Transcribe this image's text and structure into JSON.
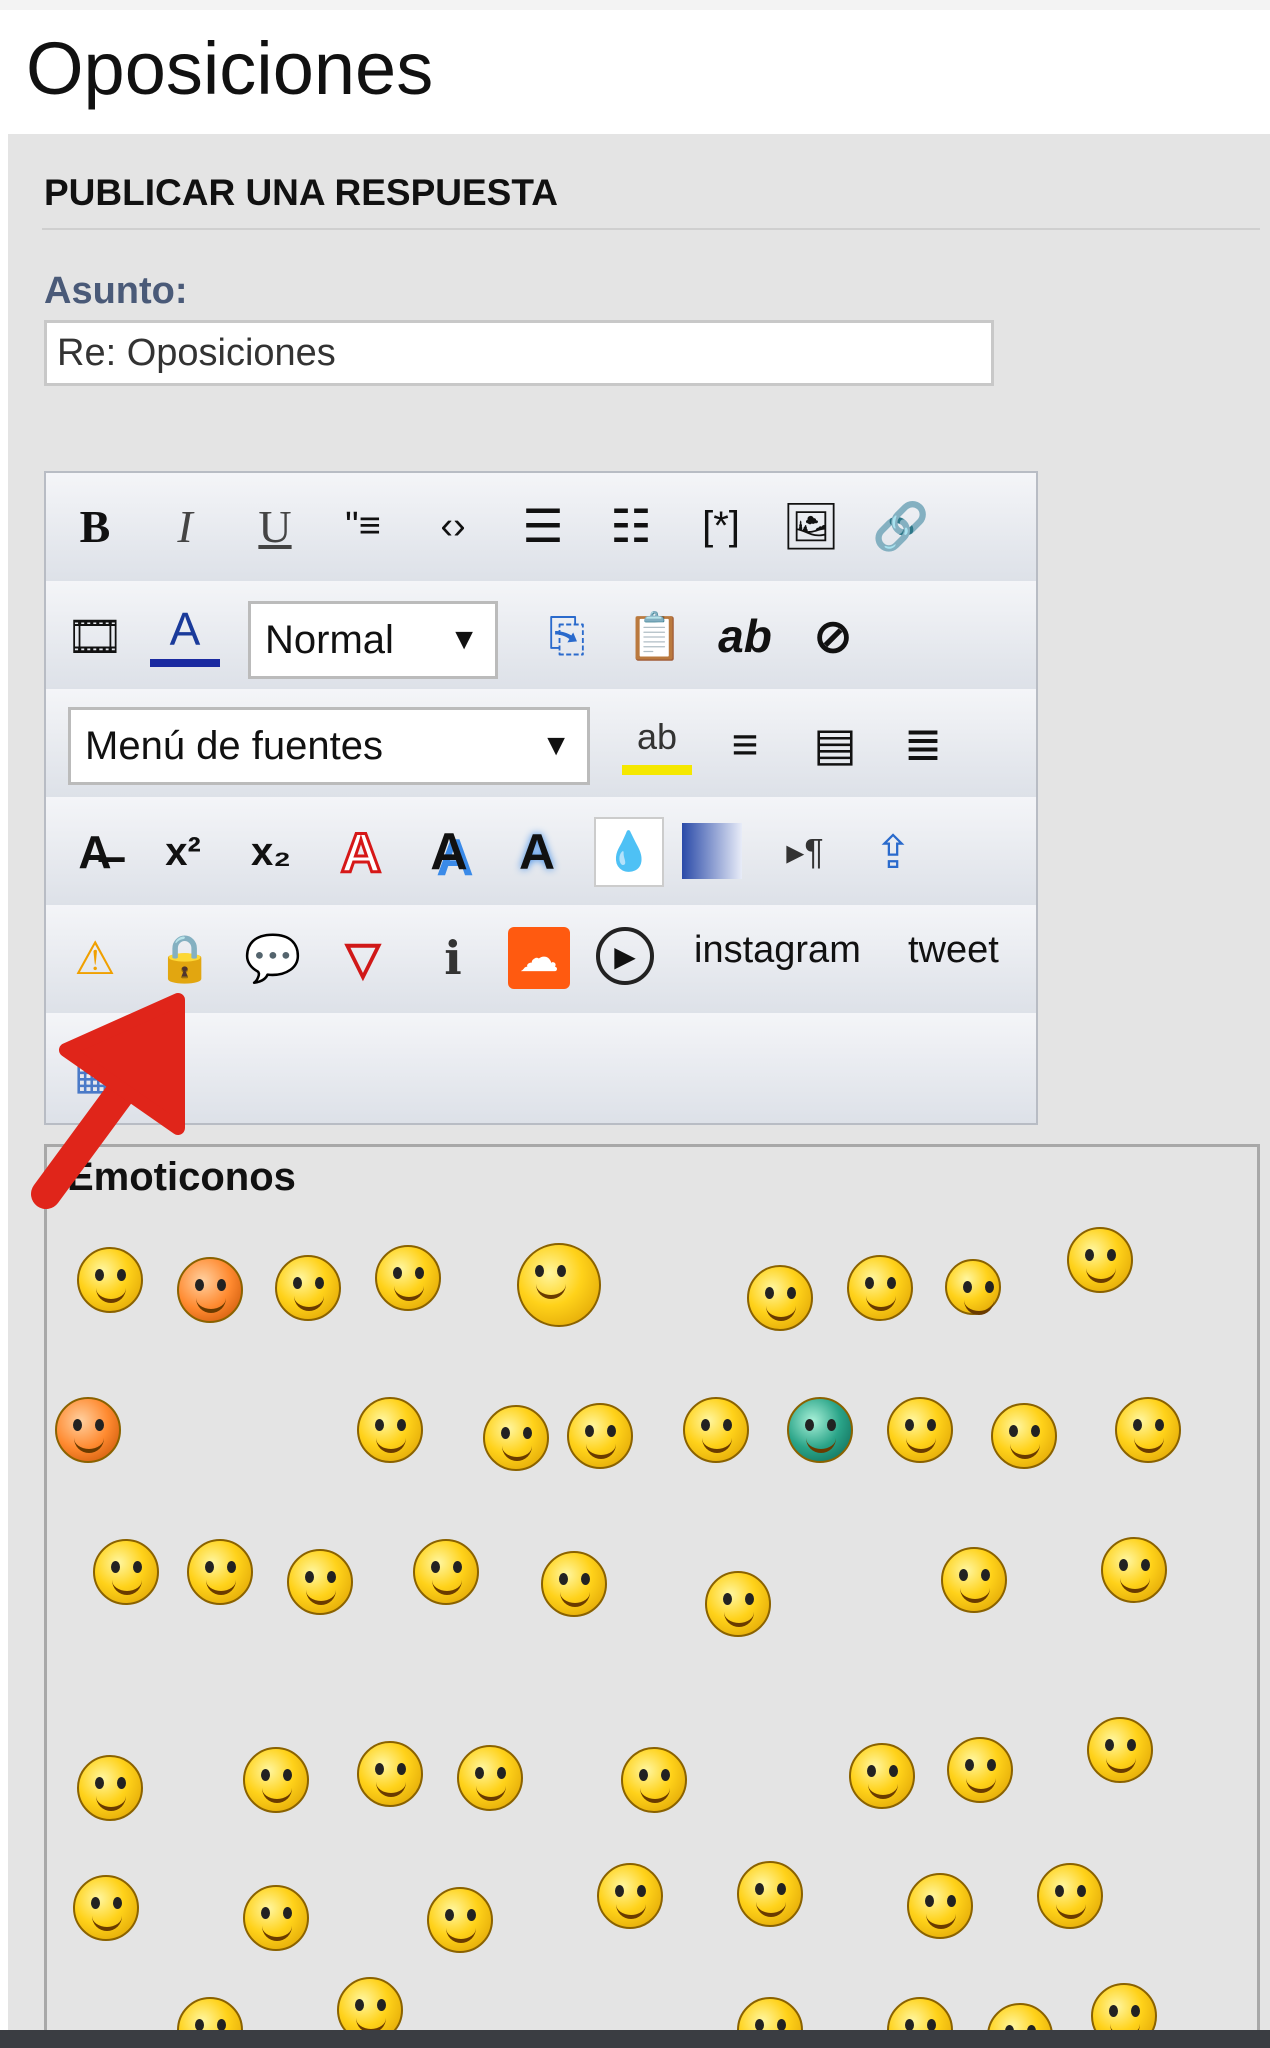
{
  "page_title": "Oposiciones",
  "section_title": "PUBLICAR UNA RESPUESTA",
  "subject": {
    "label": "Asunto:",
    "value": "Re: Oposiciones"
  },
  "toolbar": {
    "row1": [
      {
        "name": "bold-button",
        "glyph": "B"
      },
      {
        "name": "italic-button",
        "glyph": "I"
      },
      {
        "name": "underline-button",
        "glyph": "U"
      },
      {
        "name": "quote-button",
        "glyph": "\"≡"
      },
      {
        "name": "code-button",
        "glyph": "‹›"
      },
      {
        "name": "bullet-list-button",
        "glyph": "☰"
      },
      {
        "name": "numbered-list-button",
        "glyph": "☷"
      },
      {
        "name": "list-item-button",
        "glyph": "[*]"
      },
      {
        "name": "insert-image-button",
        "glyph": "🖼"
      },
      {
        "name": "insert-link-button",
        "glyph": "🔗"
      }
    ],
    "row2": [
      {
        "name": "insert-video-button",
        "glyph": "🎞"
      },
      {
        "name": "font-color-button",
        "glyph": "A"
      }
    ],
    "size_select": "Normal",
    "row2b": [
      {
        "name": "copy-button",
        "glyph": "⎘"
      },
      {
        "name": "paste-button",
        "glyph": "📋"
      },
      {
        "name": "spellcheck-button",
        "glyph": "ab"
      },
      {
        "name": "hide-text-button",
        "glyph": "⊘"
      }
    ],
    "font_select": "Menú de fuentes",
    "row3": [
      {
        "name": "highlight-button",
        "glyph": "ab"
      },
      {
        "name": "align-center-button",
        "glyph": "≡"
      },
      {
        "name": "align-justify-button",
        "glyph": "▤"
      },
      {
        "name": "align-right-button",
        "glyph": "≣"
      }
    ],
    "row4": [
      {
        "name": "strikethrough-button",
        "glyph": "A̶"
      },
      {
        "name": "superscript-button",
        "glyph": "x²"
      },
      {
        "name": "subscript-button",
        "glyph": "x₂"
      },
      {
        "name": "outline-text-button",
        "glyph": "A"
      },
      {
        "name": "shadow-text-button",
        "glyph": "A"
      },
      {
        "name": "glow-text-button",
        "glyph": "A"
      },
      {
        "name": "fade-button",
        "glyph": "💧"
      },
      {
        "name": "gradient-button",
        "glyph": "▮"
      },
      {
        "name": "rtl-button",
        "glyph": "▸¶"
      },
      {
        "name": "upload-button",
        "glyph": "⇪"
      }
    ],
    "row5": [
      {
        "name": "warning-button",
        "glyph": "⚠"
      },
      {
        "name": "lock-button",
        "glyph": "🔒"
      },
      {
        "name": "speech-bubble-button",
        "glyph": "💬"
      },
      {
        "name": "error-button",
        "glyph": "▽"
      },
      {
        "name": "info-button",
        "glyph": "ℹ"
      },
      {
        "name": "soundcloud-button",
        "glyph": "☁"
      },
      {
        "name": "play-button",
        "glyph": "▶"
      }
    ],
    "instagram_label": "instagram",
    "tweet_label": "tweet",
    "row6": [
      {
        "name": "table-button",
        "glyph": "▦"
      }
    ]
  },
  "emoticons_title": "Emoticonos",
  "colors": {
    "accent_arrow": "#e0251a",
    "panel": "#e4e4e4",
    "label": "#4a5a78"
  }
}
